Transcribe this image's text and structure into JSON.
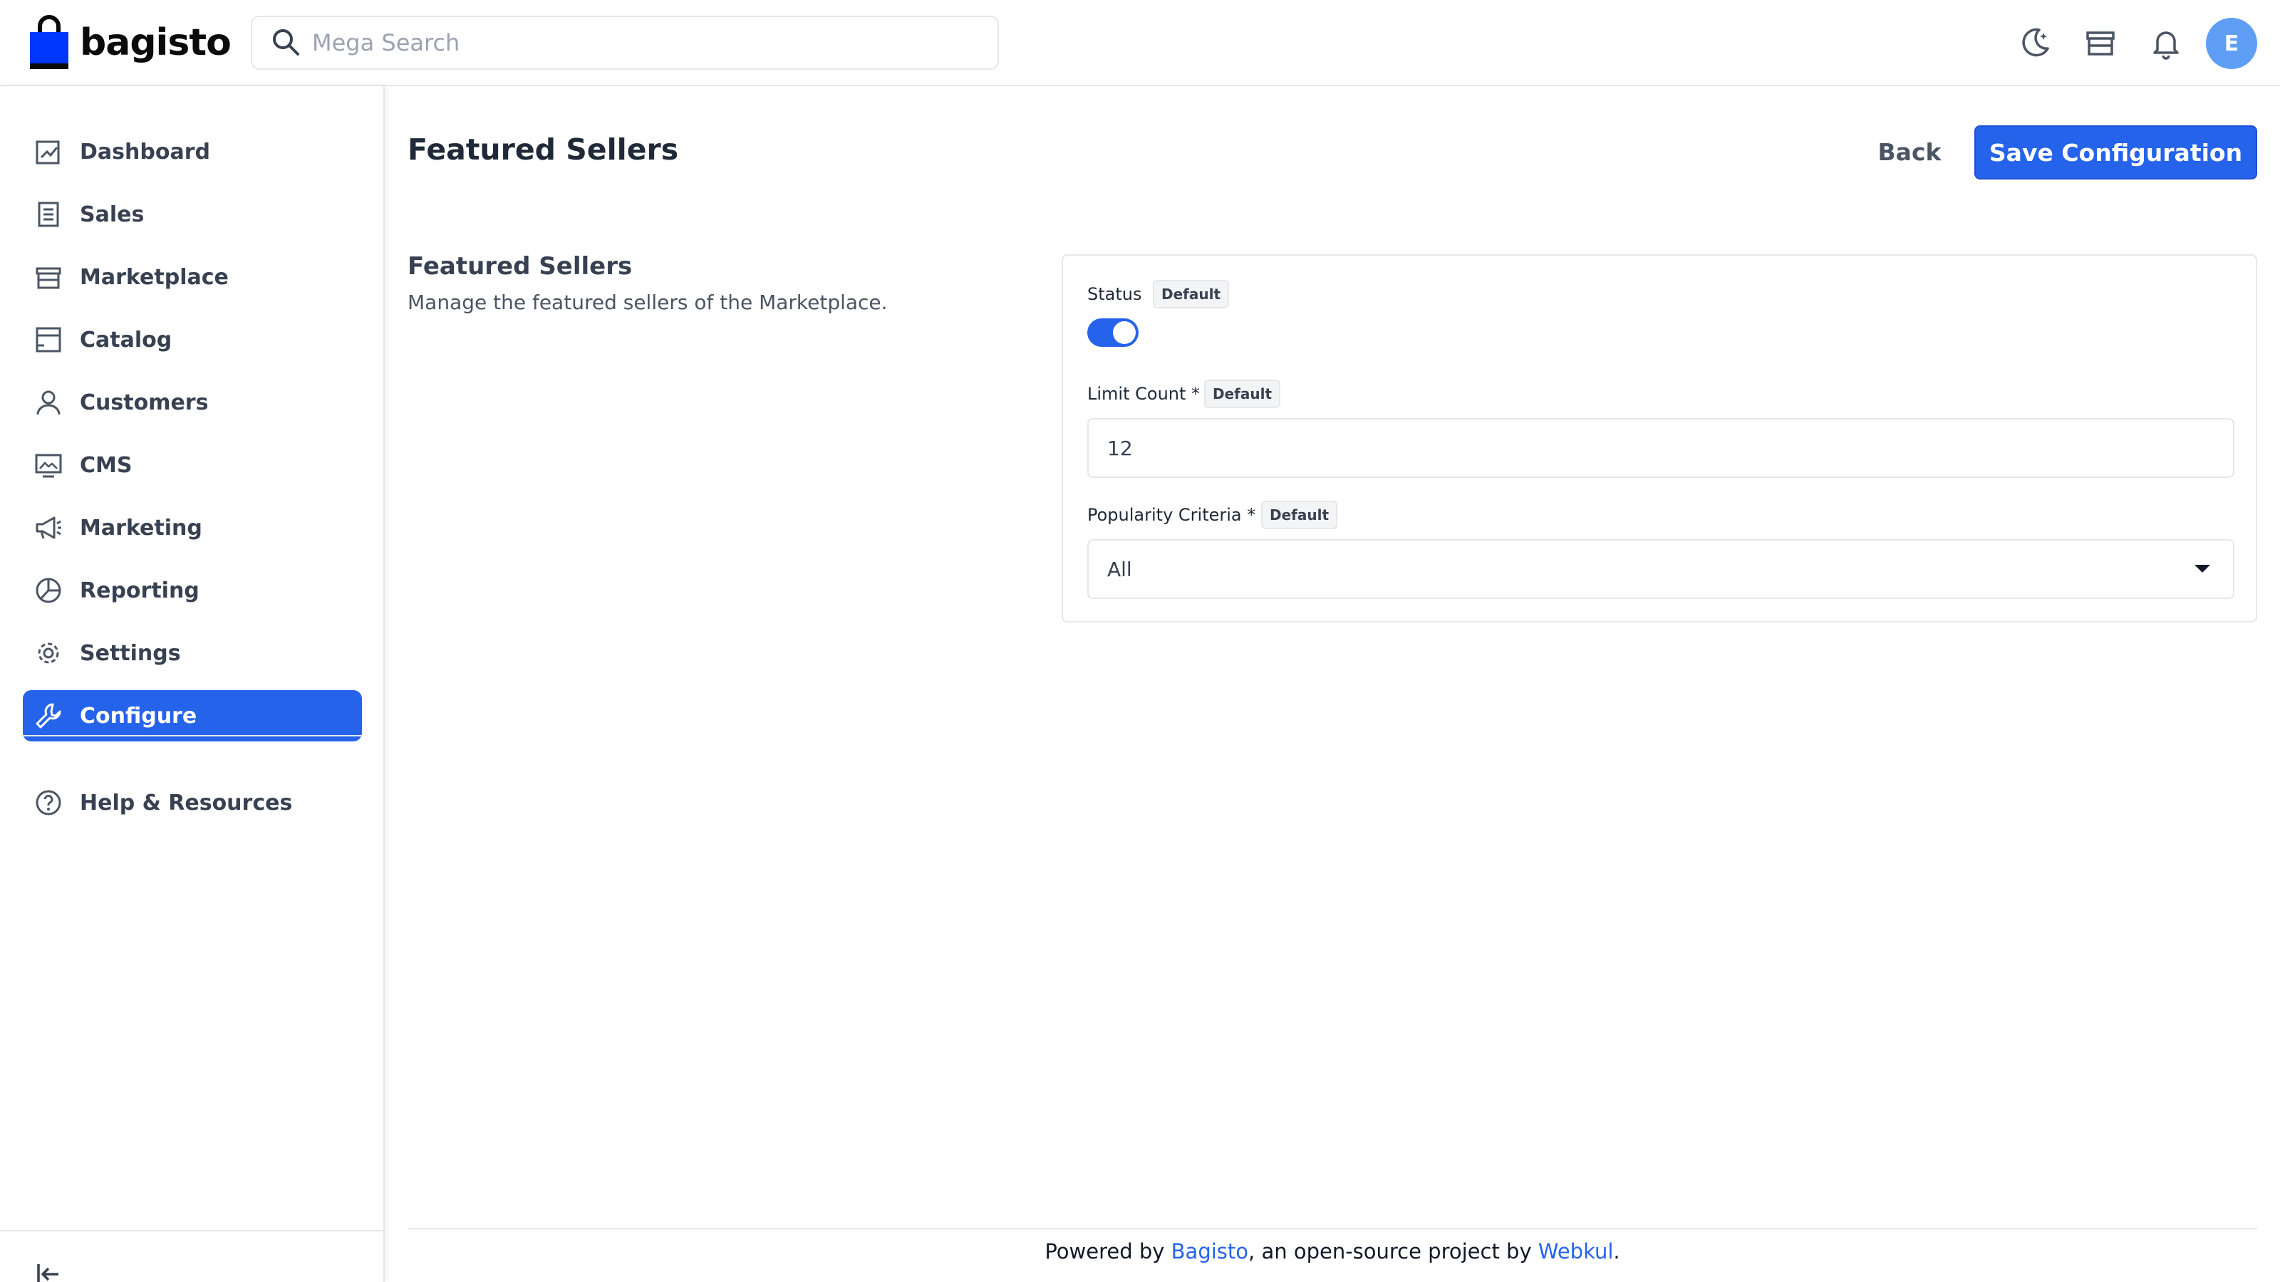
{
  "app": {
    "logo_text": "bagisto"
  },
  "header": {
    "search_placeholder": "Mega Search",
    "avatar_initial": "E"
  },
  "sidebar": {
    "items": [
      {
        "label": "Dashboard",
        "icon": "dashboard-icon"
      },
      {
        "label": "Sales",
        "icon": "receipt-icon"
      },
      {
        "label": "Marketplace",
        "icon": "store-icon"
      },
      {
        "label": "Catalog",
        "icon": "catalog-icon"
      },
      {
        "label": "Customers",
        "icon": "user-icon"
      },
      {
        "label": "CMS",
        "icon": "monitor-icon"
      },
      {
        "label": "Marketing",
        "icon": "megaphone-icon"
      },
      {
        "label": "Reporting",
        "icon": "pie-chart-icon"
      },
      {
        "label": "Settings",
        "icon": "gear-icon"
      },
      {
        "label": "Configure",
        "icon": "wrench-icon",
        "active": true
      }
    ],
    "help_label": "Help & Resources"
  },
  "page": {
    "title": "Featured Sellers",
    "back_label": "Back",
    "save_label": "Save Configuration"
  },
  "section": {
    "title": "Featured Sellers",
    "description": "Manage the featured sellers of the Marketplace."
  },
  "form": {
    "status": {
      "label": "Status",
      "badge": "Default",
      "enabled": true
    },
    "limit_count": {
      "label": "Limit Count *",
      "badge": "Default",
      "value": "12"
    },
    "popularity_criteria": {
      "label": "Popularity Criteria *",
      "badge": "Default",
      "value": "All"
    }
  },
  "footer": {
    "prefix": "Powered by ",
    "link1": "Bagisto",
    "middle": ", an open-source project by ",
    "link2": "Webkul",
    "suffix": "."
  },
  "colors": {
    "accent": "#2563eb",
    "avatar": "#5e9ef4",
    "text": "#374151",
    "border": "#e5e7eb"
  }
}
